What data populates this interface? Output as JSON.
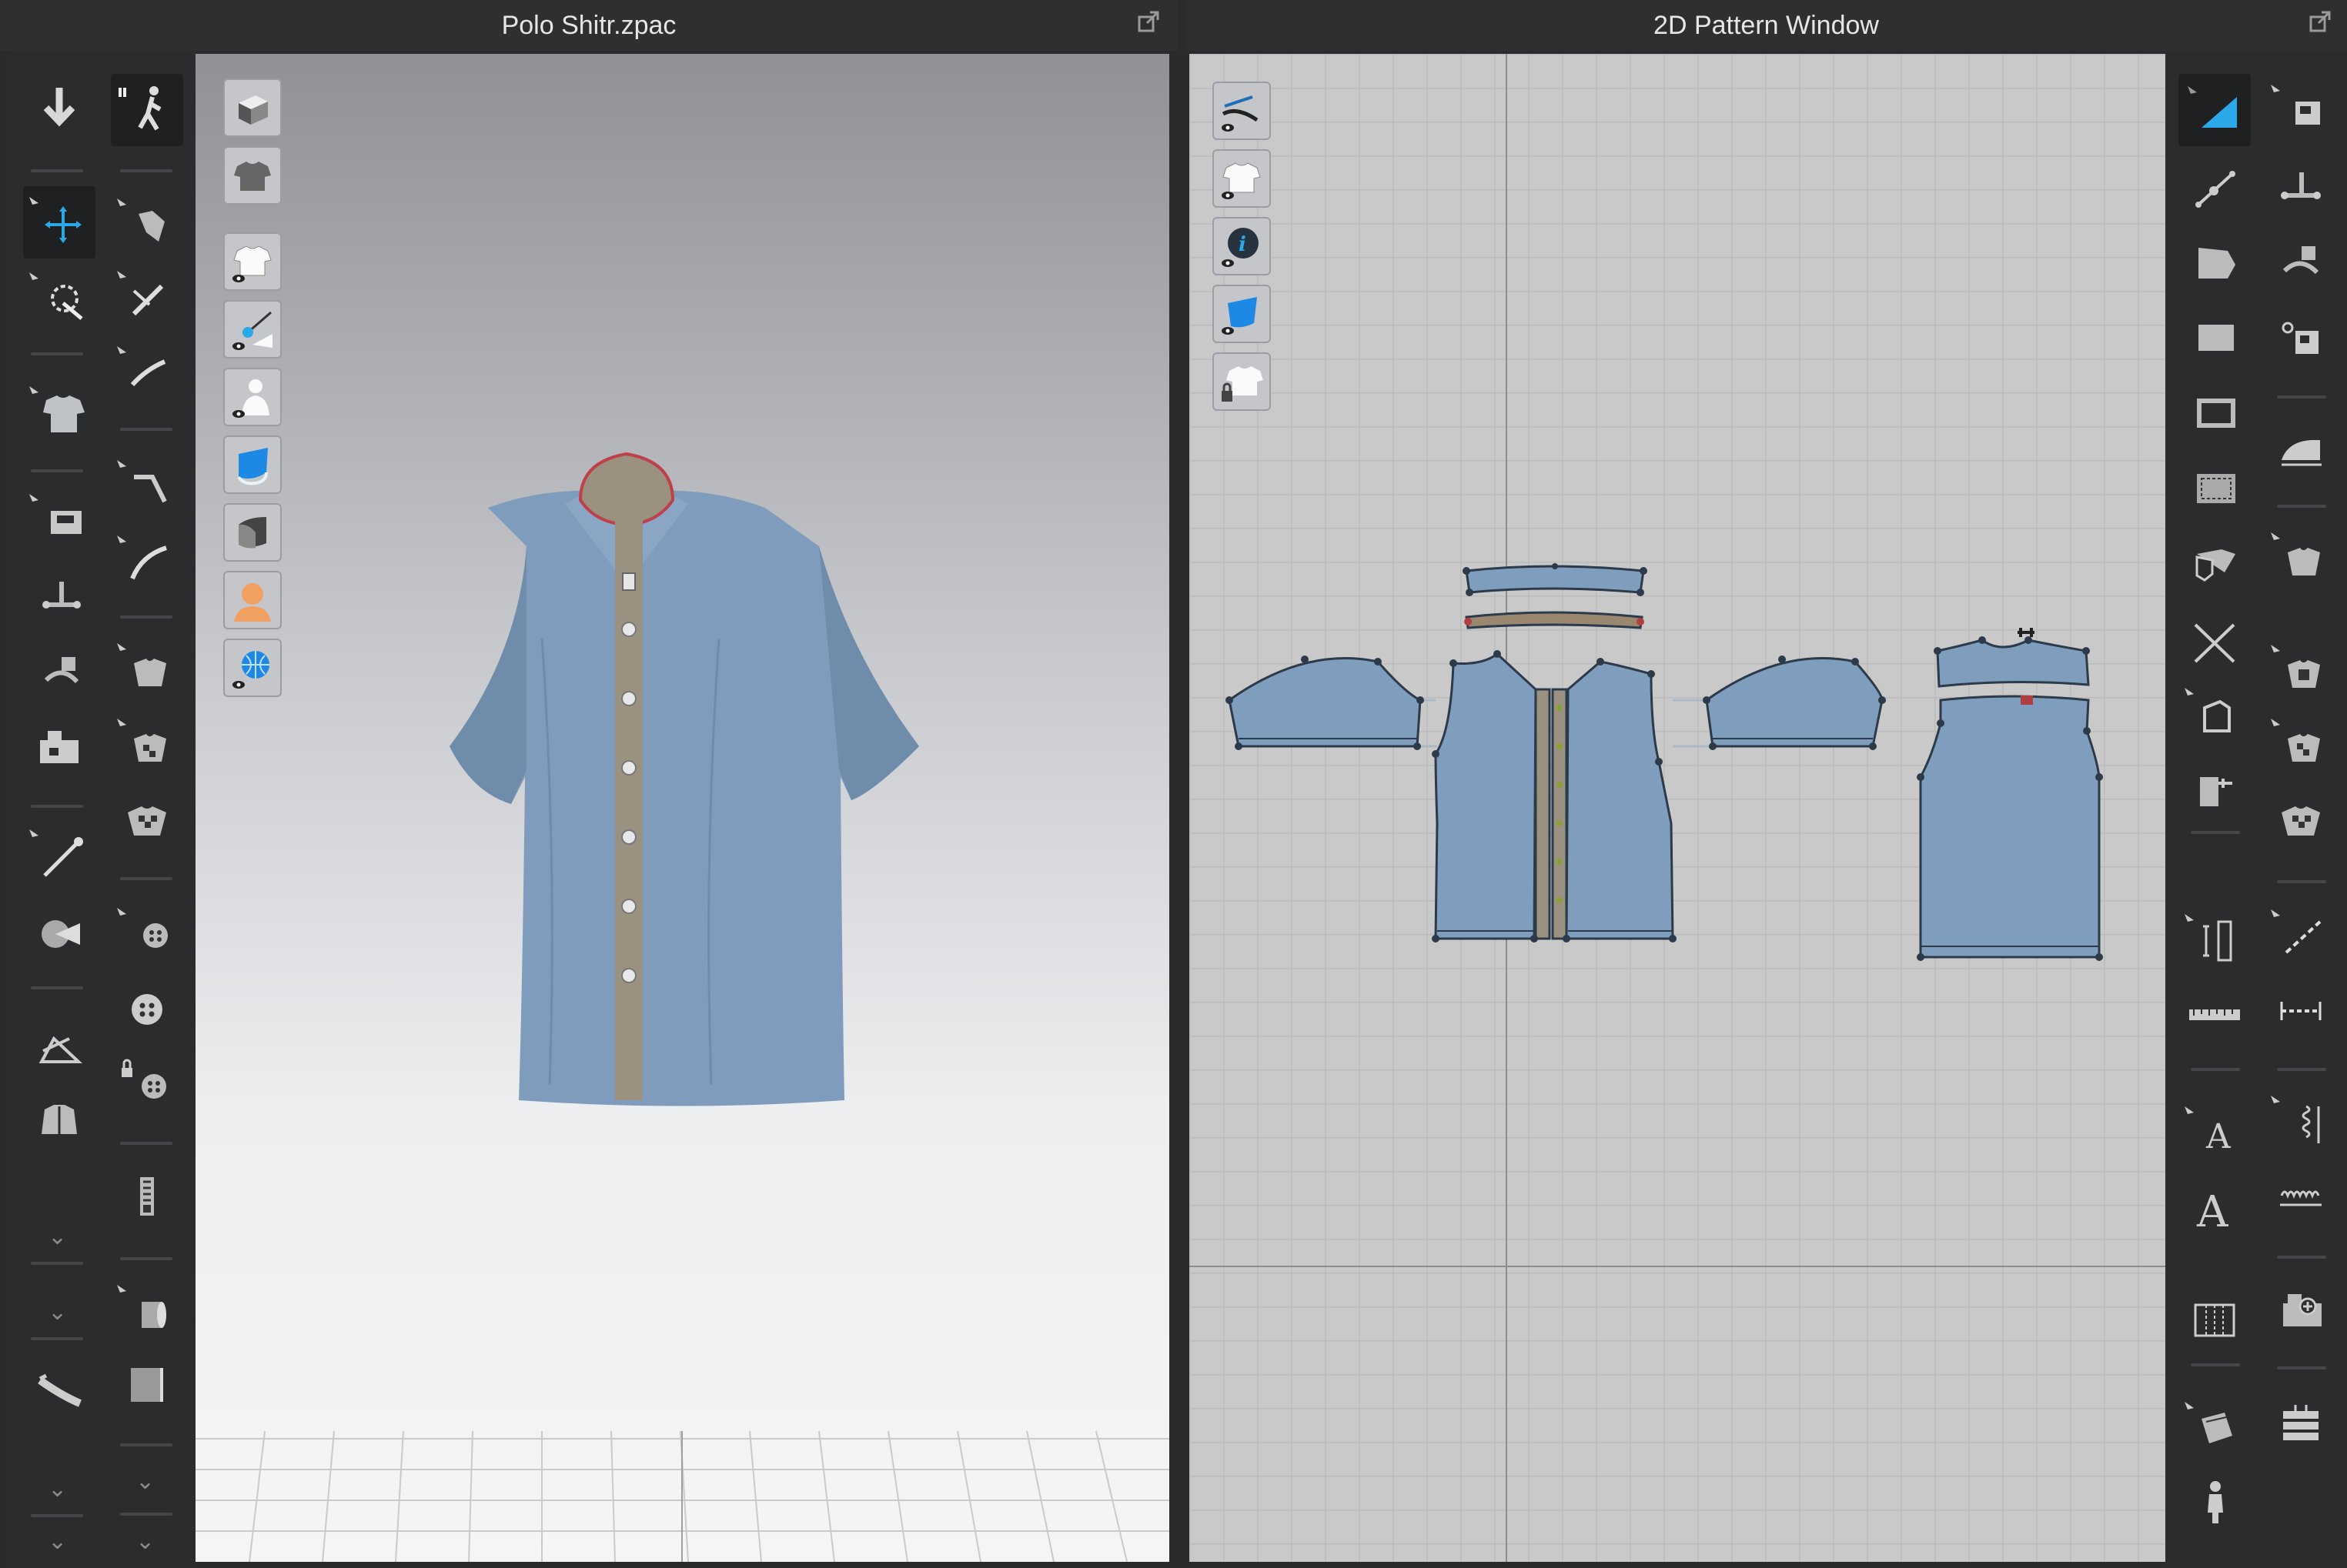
{
  "left_window": {
    "title": "Polo Shitr.zpac"
  },
  "right_window": {
    "title": "2D Pattern Window"
  },
  "toolbar_3d_col1": [
    "down-arrow-icon",
    "move-gizmo-icon",
    "select-mesh-icon",
    "shirt-simulate-icon",
    "sewing-machine-icon",
    "segment-sew-icon",
    "free-sew-icon",
    "sewing-ops-icon",
    "pin-icon",
    "fold-arrange-icon",
    "arrange-points-icon",
    "avatar-jacket-icon",
    "tape-measure-icon"
  ],
  "toolbar_3d_col2": [
    "walk-avatar-icon",
    "select-pattern-icon",
    "edit-pattern-icon",
    "edit-curve-icon",
    "segment-icon",
    "free-curve-icon",
    "texture-edit-icon",
    "texture-transform-icon",
    "graphic-icon",
    "button-add-icon",
    "button-icon",
    "button-lock-icon",
    "zipper-icon",
    "fabric-roll-icon",
    "fabric-block-icon"
  ],
  "viewport3d_tools": [
    "box-view-icon",
    "shirt-back-icon",
    "show-garment-icon",
    "show-pins-icon",
    "show-avatar-icon",
    "fabric-blue-icon",
    "fabric-gray-icon",
    "avatar-head-icon",
    "globe-icon"
  ],
  "viewport2d_tools": [
    "pattern-needle-icon",
    "show-garment-2d-icon",
    "info-icon",
    "fabric-2d-icon",
    "lock-garment-icon"
  ],
  "toolbar_2d_col1": [
    "transform-pattern-icon",
    "edit-point-icon",
    "add-point-icon",
    "polygon-icon",
    "rectangle-icon",
    "internal-polygon-icon",
    "trace-icon",
    "cut-icon",
    "notch-icon",
    "seam-allowance-icon",
    "ruler-icon",
    "text-icon",
    "annotation-icon",
    "grading-icon",
    "symmetry-icon",
    "avatar-edit-icon"
  ],
  "toolbar_2d_col2": [
    "sew-segment-icon",
    "sew-free-icon",
    "sew-n-icon",
    "sew-check-icon",
    "iron-icon",
    "fold-icon",
    "tack-icon",
    "puckering-icon",
    "shirring-icon",
    "topstitch-icon",
    "stitch-line-icon",
    "elastic-icon",
    "zigzag-icon",
    "sew-add-icon",
    "fabric-stack-icon"
  ],
  "colors": {
    "fabric": "#7f9cbc",
    "placket": "#9a9180",
    "accent": "#2aa8e8",
    "pattern_fill": "#7f9dbc",
    "pattern_edge": "#2c3a4a"
  }
}
